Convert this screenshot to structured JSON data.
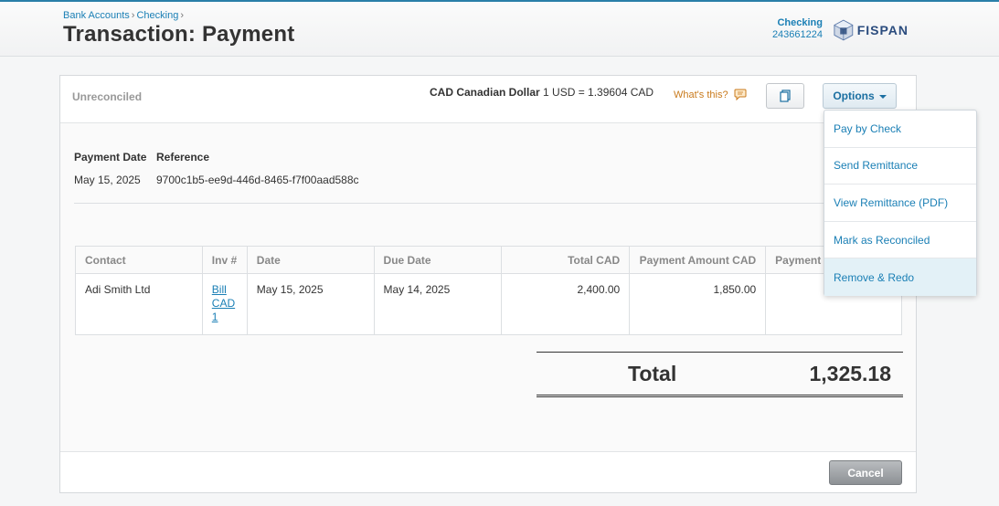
{
  "breadcrumb": [
    "Bank Accounts",
    "Checking"
  ],
  "page_title": "Transaction: Payment",
  "account": {
    "name": "Checking",
    "number": "243661224"
  },
  "brand": {
    "logo_text": "FISPAN"
  },
  "panel": {
    "status": "Unreconciled",
    "currency_code_name": "CAD Canadian Dollar",
    "rate_text": "1 USD = 1.39604 CAD",
    "whats_this": "What's this?",
    "options_label": "Options"
  },
  "details": {
    "payment_date_label": "Payment Date",
    "payment_date": "May 15, 2025",
    "reference_label": "Reference",
    "reference": "9700c1b5-ee9d-446d-8465-f7f00aad588c"
  },
  "table": {
    "headers": [
      "Contact",
      "Inv #",
      "Date",
      "Due Date",
      "Total CAD",
      "Payment Amount CAD",
      "Payment"
    ],
    "rows": [
      {
        "contact": "Adi Smith Ltd",
        "inv": "Bill CAD 1",
        "date": "May 15, 2025",
        "due": "May 14, 2025",
        "total": "2,400.00",
        "amount": "1,850.00",
        "payment": ""
      }
    ]
  },
  "total": {
    "label": "Total",
    "value": "1,325.18"
  },
  "footer": {
    "cancel_label": "Cancel"
  },
  "options_menu": [
    "Pay by Check",
    "Send Remittance",
    "View Remittance (PDF)",
    "Mark as Reconciled",
    "Remove & Redo"
  ],
  "colors": {
    "link": "#1a7fb5",
    "accent": "#2a7fa8",
    "warning": "#c97a1c"
  },
  "icons": {
    "copy": "copy-icon",
    "help": "speech-bubble-icon",
    "logo": "cube-logo-icon",
    "caret": "caret-down-icon"
  }
}
